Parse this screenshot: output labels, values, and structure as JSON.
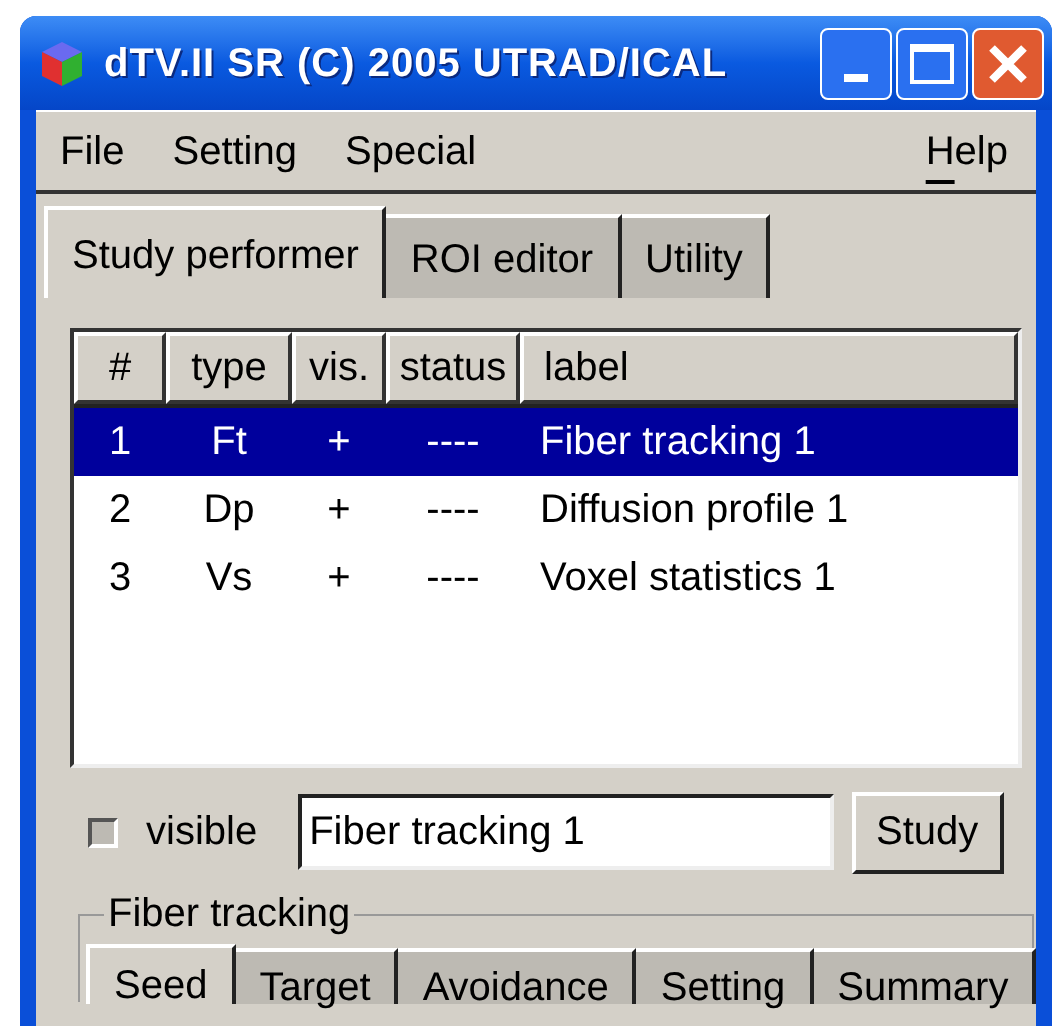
{
  "window": {
    "title": "dTV.II SR (C) 2005 UTRAD/ICAL"
  },
  "menu": [
    {
      "label": "File",
      "mnemonic_first": false
    },
    {
      "label": "Setting",
      "mnemonic_first": false
    },
    {
      "label": "Special",
      "mnemonic_first": false
    },
    {
      "label": "Help",
      "mnemonic_first": true
    }
  ],
  "tabs": [
    {
      "label": "Study performer",
      "selected": true
    },
    {
      "label": "ROI editor",
      "selected": false
    },
    {
      "label": "Utility",
      "selected": false
    }
  ],
  "table": {
    "columns": [
      "#",
      "type",
      "vis.",
      "status",
      "label"
    ],
    "rows": [
      {
        "cells": [
          "1",
          "Ft",
          "+",
          "----",
          "Fiber tracking 1"
        ],
        "selected": true
      },
      {
        "cells": [
          "2",
          "Dp",
          "+",
          "----",
          "Diffusion profile 1"
        ],
        "selected": false
      },
      {
        "cells": [
          "3",
          "Vs",
          "+",
          "----",
          "Voxel statistics 1"
        ],
        "selected": false
      }
    ]
  },
  "visible": {
    "label": "visible",
    "checked": false
  },
  "name_field": {
    "value": "Fiber tracking 1"
  },
  "study_button": {
    "label": "Study"
  },
  "group": {
    "title": "Fiber tracking",
    "tabs": [
      {
        "label": "Seed",
        "selected": true
      },
      {
        "label": "Target",
        "selected": false
      },
      {
        "label": "Avoidance",
        "selected": false
      },
      {
        "label": "Setting",
        "selected": false
      },
      {
        "label": "Summary",
        "selected": false
      }
    ]
  }
}
